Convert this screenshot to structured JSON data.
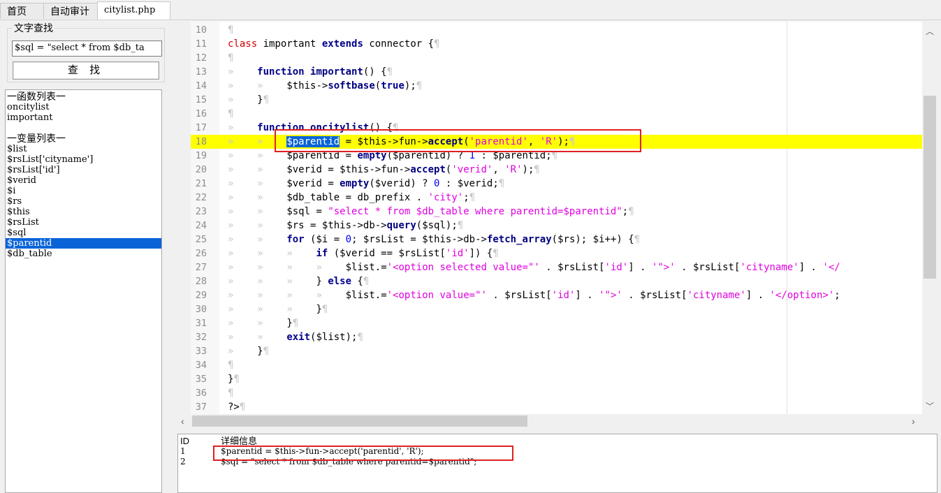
{
  "tabs": [
    {
      "label": "首页",
      "active": false
    },
    {
      "label": "自动审计",
      "active": false
    },
    {
      "label": "citylist.php",
      "active": true
    }
  ],
  "search": {
    "group_title": "文字查找",
    "value": "$sql = \"select * from $db_ta",
    "button_label": "查 找"
  },
  "symbols": {
    "functions_header": "一函数列表一",
    "functions": [
      "oncitylist",
      "important"
    ],
    "variables_header": "一变量列表一",
    "variables": [
      "$list",
      "$rsList['cityname']",
      "$rsList['id']",
      "$verid",
      "$i",
      "$rs",
      "$this",
      "$rsList",
      "$sql",
      "$parentid",
      "$db_table"
    ],
    "selected_variable": "$parentid"
  },
  "editor": {
    "line_numbers": [
      "10",
      "11",
      "12",
      "13",
      "14",
      "15",
      "16",
      "17",
      "18",
      "19",
      "20",
      "21",
      "22",
      "23",
      "24",
      "25",
      "26",
      "27",
      "28",
      "29",
      "30",
      "31",
      "32",
      "33",
      "34",
      "35",
      "36",
      "37"
    ],
    "highlighted_line": "18",
    "code": {
      "l10": "",
      "l11_kw1": "class",
      "l11_name": " important ",
      "l11_kw2": "extends",
      "l11_rest": " connector {",
      "l13_kw": "function",
      "l13_fn": "important",
      "l13_rest": "() {",
      "l14_a": "$this->",
      "l14_fn": "softbase",
      "l14_b": "(",
      "l14_c": "true",
      "l14_d": ");",
      "l15": "}",
      "l17_kw": "function",
      "l17_fn": "oncitylist",
      "l17_rest": "() {",
      "l18_var": "$parentid",
      "l18_a": " = $this->fun->",
      "l18_fn": "accept",
      "l18_b": "(",
      "l18_s1": "'parentid'",
      "l18_c": ", ",
      "l18_s2": "'R'",
      "l18_d": ");",
      "l19_a": "$parentid = ",
      "l19_fn": "empty",
      "l19_b": "($parentid) ? ",
      "l19_n1": "1",
      "l19_c": " : $parentid;",
      "l20_a": "$verid = $this->fun->",
      "l20_fn": "accept",
      "l20_b": "(",
      "l20_s1": "'verid'",
      "l20_c": ", ",
      "l20_s2": "'R'",
      "l20_d": ");",
      "l21_a": "$verid = ",
      "l21_fn": "empty",
      "l21_b": "($verid) ? ",
      "l21_n1": "0",
      "l21_c": " : $verid;",
      "l22_a": "$db_table = db_prefix . ",
      "l22_s": "'city'",
      "l22_b": ";",
      "l23_a": "$sql = ",
      "l23_s": "\"select * from $db_table where parentid=$parentid\"",
      "l23_b": ";",
      "l24_a": "$rs = $this->db->",
      "l24_fn": "query",
      "l24_b": "($sql);",
      "l25_kw": "for",
      "l25_a": " ($i = ",
      "l25_n": "0",
      "l25_b": "; $rsList = $this->db->",
      "l25_fn": "fetch_array",
      "l25_c": "($rs); $i++) {",
      "l26_kw": "if",
      "l26_a": " ($verid == $rsList[",
      "l26_s": "'id'",
      "l26_b": "]) {",
      "l27_a": "$list.=",
      "l27_s1": "'<option selected value=\"'",
      "l27_b": " . $rsList[",
      "l27_s2": "'id'",
      "l27_c": "] . ",
      "l27_s3": "'\">'",
      "l27_d": " . $rsList[",
      "l27_s4": "'cityname'",
      "l27_e": "] . ",
      "l27_s5": "'</",
      "l28_a": "} ",
      "l28_kw": "else",
      "l28_b": " {",
      "l29_a": "$list.=",
      "l29_s1": "'<option value=\"'",
      "l29_b": " . $rsList[",
      "l29_s2": "'id'",
      "l29_c": "] . ",
      "l29_s3": "'\">'",
      "l29_d": " . $rsList[",
      "l29_s4": "'cityname'",
      "l29_e": "] . ",
      "l29_s5": "'</option>'",
      "l29_f": ";",
      "l30": "}",
      "l31": "}",
      "l32_kw": "exit",
      "l32_a": "($list);",
      "l33": "}",
      "l35": "}",
      "l37": "?>"
    }
  },
  "details": {
    "col_id": "ID",
    "col_info": "详细信息",
    "rows": [
      {
        "id": "1",
        "info": "$parentid = $this->fun->accept('parentid', 'R');"
      },
      {
        "id": "2",
        "info": "$sql = \"select * from $db_table where parentid=$parentid\";"
      }
    ]
  },
  "colors": {
    "highlight_line": "#ffff00",
    "selection": "#0a64d8",
    "annotation_box": "#e02020",
    "keyword": "#00008b",
    "string": "#e000e0",
    "class_keyword": "#d00000"
  }
}
